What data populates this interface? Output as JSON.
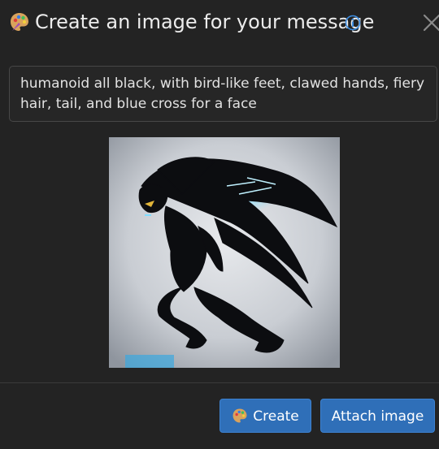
{
  "dialog": {
    "title": "Create an image for your message",
    "title_icon": "palette-icon",
    "info_icon": "info-icon",
    "close_icon": "close-icon"
  },
  "prompt": {
    "value": "humanoid all black, with bird-like feet, clawed hands, fiery hair, tail, and blue cross for a face"
  },
  "image": {
    "description_name": "generated-image"
  },
  "actions": {
    "create_label": "Create",
    "create_icon": "palette-icon",
    "attach_label": "Attach image"
  },
  "colors": {
    "background": "#232323",
    "accent": "#2f6fb8",
    "info": "#3a8be0"
  }
}
